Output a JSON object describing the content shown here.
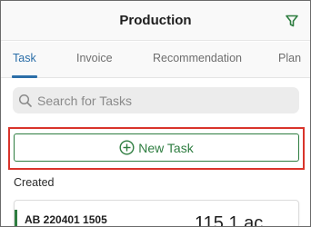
{
  "header": {
    "title": "Production",
    "filter_icon": "filter-icon"
  },
  "tabs": [
    {
      "label": "Task",
      "active": true
    },
    {
      "label": "Invoice",
      "active": false
    },
    {
      "label": "Recommendation",
      "active": false
    },
    {
      "label": "Plan",
      "active": false
    }
  ],
  "search": {
    "placeholder": "Search for Tasks",
    "icon": "search-icon"
  },
  "new_task": {
    "label": "New Task",
    "icon": "plus-circle-icon"
  },
  "section": {
    "created_label": "Created"
  },
  "task_card": {
    "id": "AB 220401 1505",
    "value": "115 1 ac"
  },
  "colors": {
    "accent_blue": "#2b6ea8",
    "action_green": "#2e7d40",
    "highlight_red": "#d9342b"
  }
}
